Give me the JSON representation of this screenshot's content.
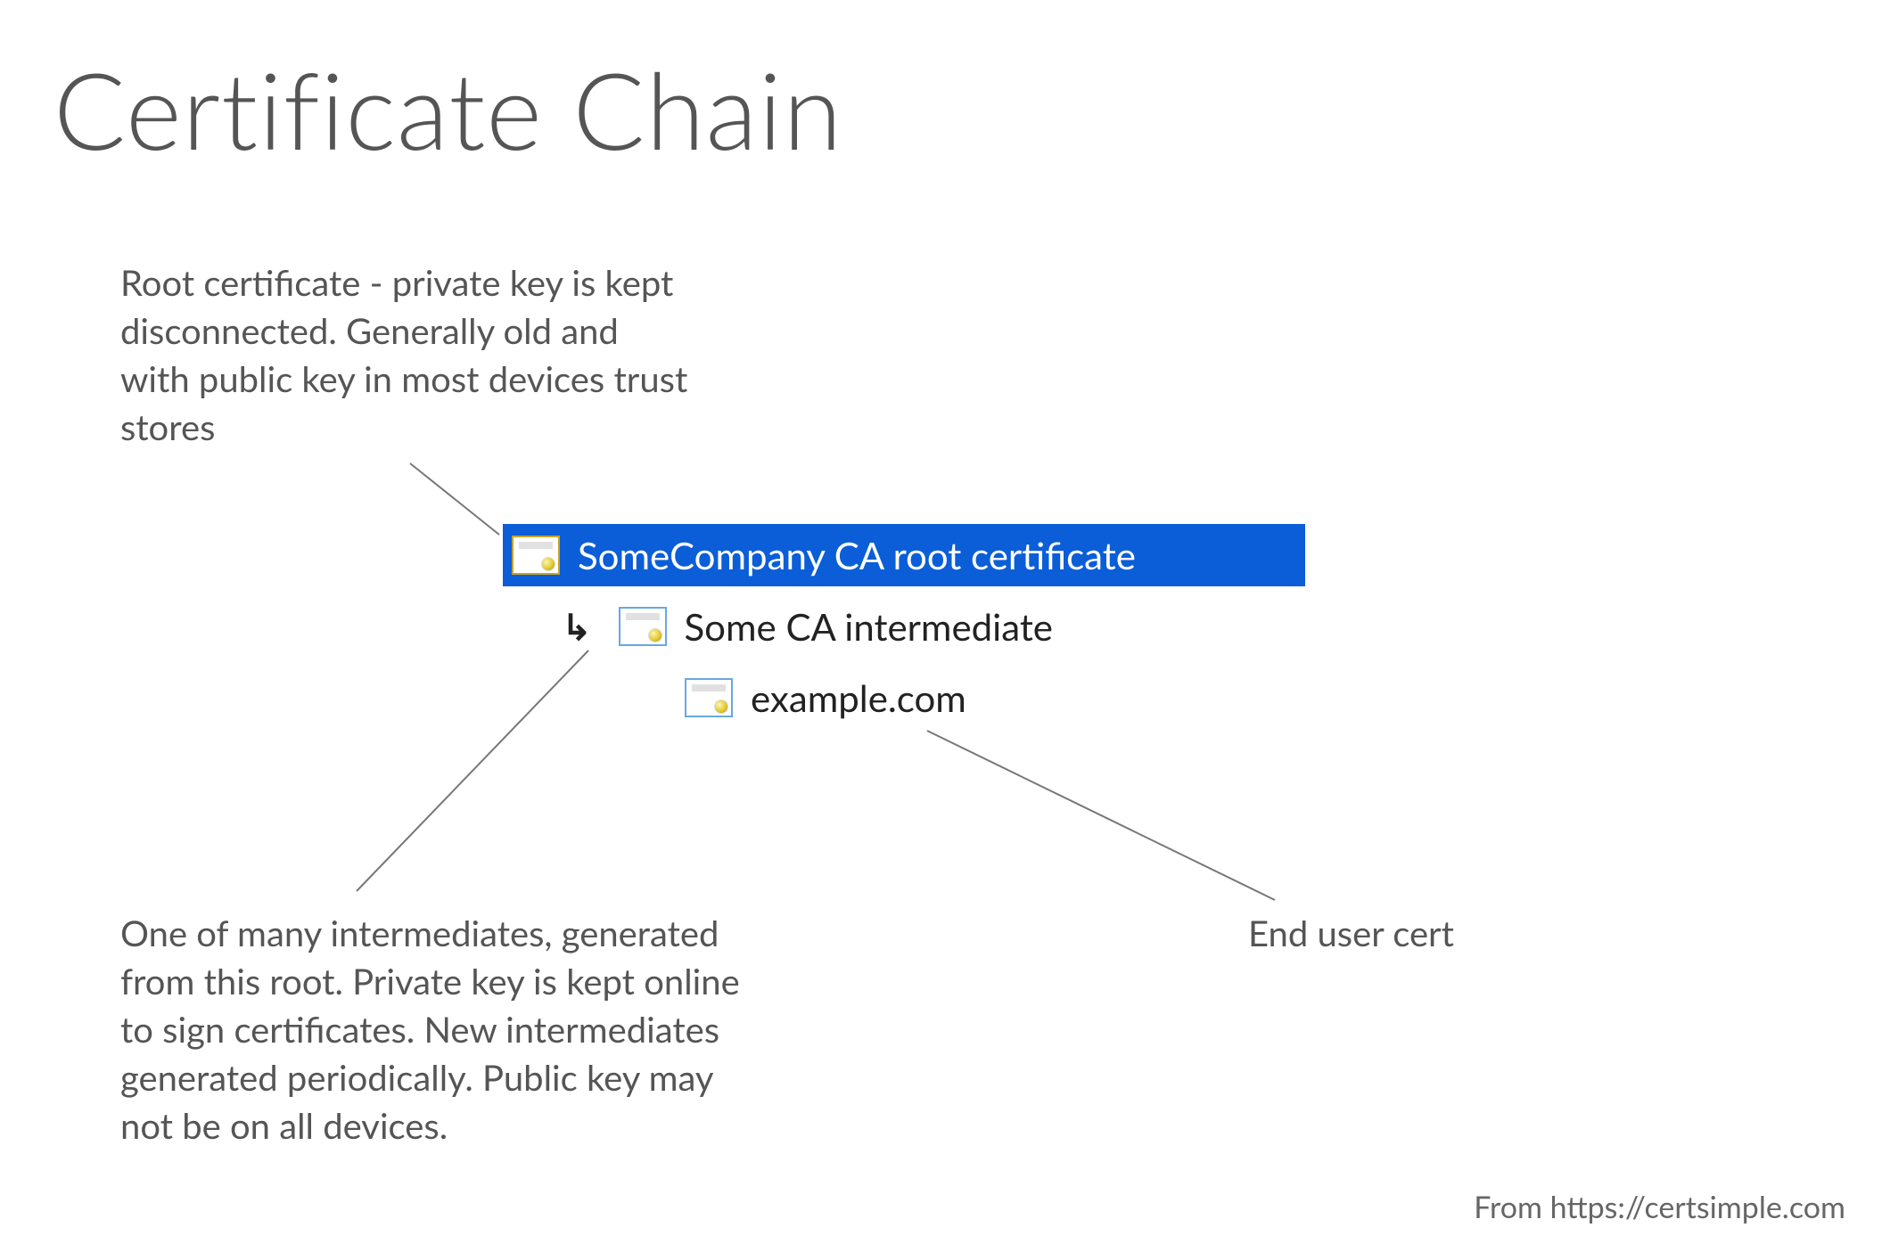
{
  "title": "Certificate Chain",
  "annotations": {
    "root": "Root certificate - private key is kept disconnected. Generally old and with public key in most devices trust stores",
    "intermediate": "One of many intermediates, generated from this root. Private key is kept online to sign certificates. New intermediates generated periodically. Public key may not be on all devices.",
    "end": "End user cert"
  },
  "certs": {
    "root_label": "SomeCompany CA root certificate",
    "intermediate_label": "Some CA intermediate",
    "end_label": "example.com"
  },
  "footer": "From https://certsimple.com"
}
